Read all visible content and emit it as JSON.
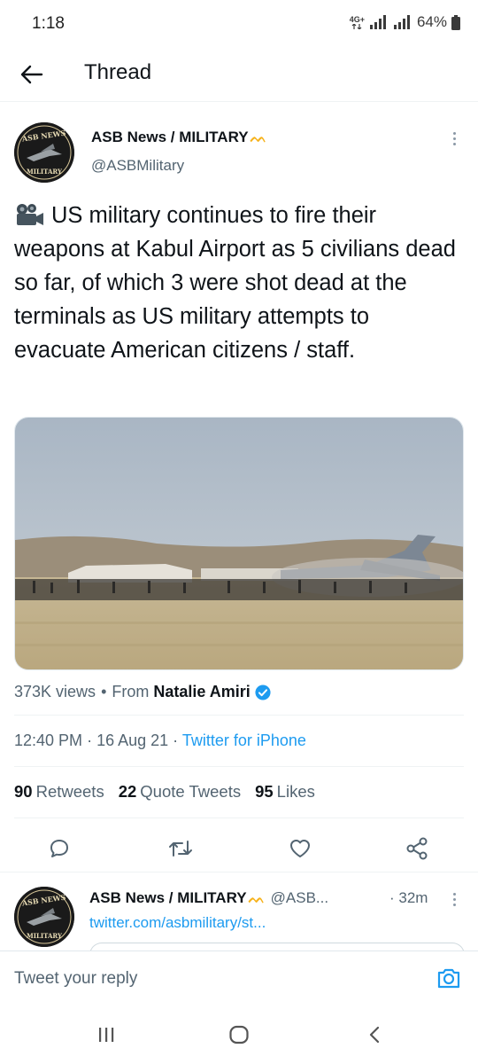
{
  "status_bar": {
    "time": "1:18",
    "network": "4G+",
    "battery": "64%"
  },
  "header": {
    "title": "Thread",
    "back_icon": "arrow-left-icon"
  },
  "tweet": {
    "author_name": "ASB News / MILITARY",
    "author_handle": "@ASBMilitary",
    "text": "US military continues to fire their weapons at Kabul Airport as 5 civilians dead so far, of which 3 were shot dead at the terminals as US military attempts to evacuate American citizens / staff.",
    "media_icon": "video-camera-icon",
    "views": "373K views",
    "from_label": "From",
    "from_name": "Natalie Amiri",
    "time": "12:40 PM",
    "date": "16 Aug 21",
    "source": "Twitter for iPhone",
    "retweets_count": "90",
    "retweets_label": "Retweets",
    "quotes_count": "22",
    "quotes_label": "Quote Tweets",
    "likes_count": "95",
    "likes_label": "Likes"
  },
  "actions": [
    "reply-icon",
    "retweet-icon",
    "like-icon",
    "share-icon"
  ],
  "reply": {
    "author_name": "ASB News / MILITARY",
    "author_handle": "@ASB...",
    "time": "· 32m",
    "link": "twitter.com/asbmilitary/st..."
  },
  "compose": {
    "placeholder": "Tweet your reply"
  },
  "colors": {
    "accent": "#1d9bf0",
    "crown": "#f6b21b",
    "secondary_text": "#536471"
  }
}
